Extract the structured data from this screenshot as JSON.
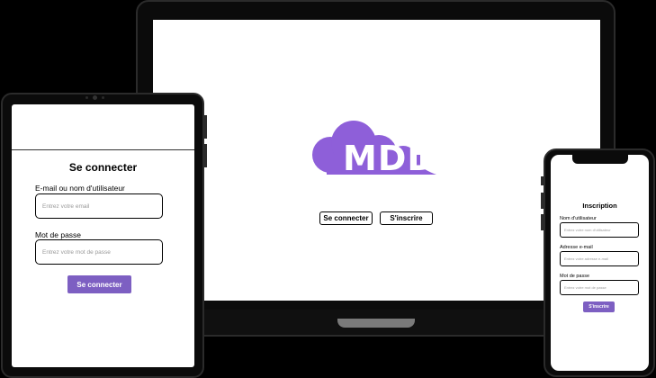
{
  "laptop": {
    "logo_text": "MDD",
    "brand_color": "#8e5fd9",
    "login_button": "Se connecter",
    "register_button": "S'inscrire"
  },
  "tablet": {
    "title": "Se connecter",
    "email_label": "E-mail ou nom d'utilisateur",
    "email_placeholder": "Entrez votre email",
    "password_label": "Mot de passe",
    "password_placeholder": "Entrez votre mot de passe",
    "submit_button": "Se connecter",
    "button_color": "#7d5fc2"
  },
  "phone": {
    "title": "Inscription",
    "username_label": "Nom d'utilisateur",
    "username_placeholder": "Entrez votre nom d'utilisateur",
    "email_label": "Adresse e-mail",
    "email_placeholder": "Entrez votre adresse e-mail",
    "password_label": "Mot de passe",
    "password_placeholder": "Entrez votre mot de passe",
    "submit_button": "S'inscrire"
  }
}
